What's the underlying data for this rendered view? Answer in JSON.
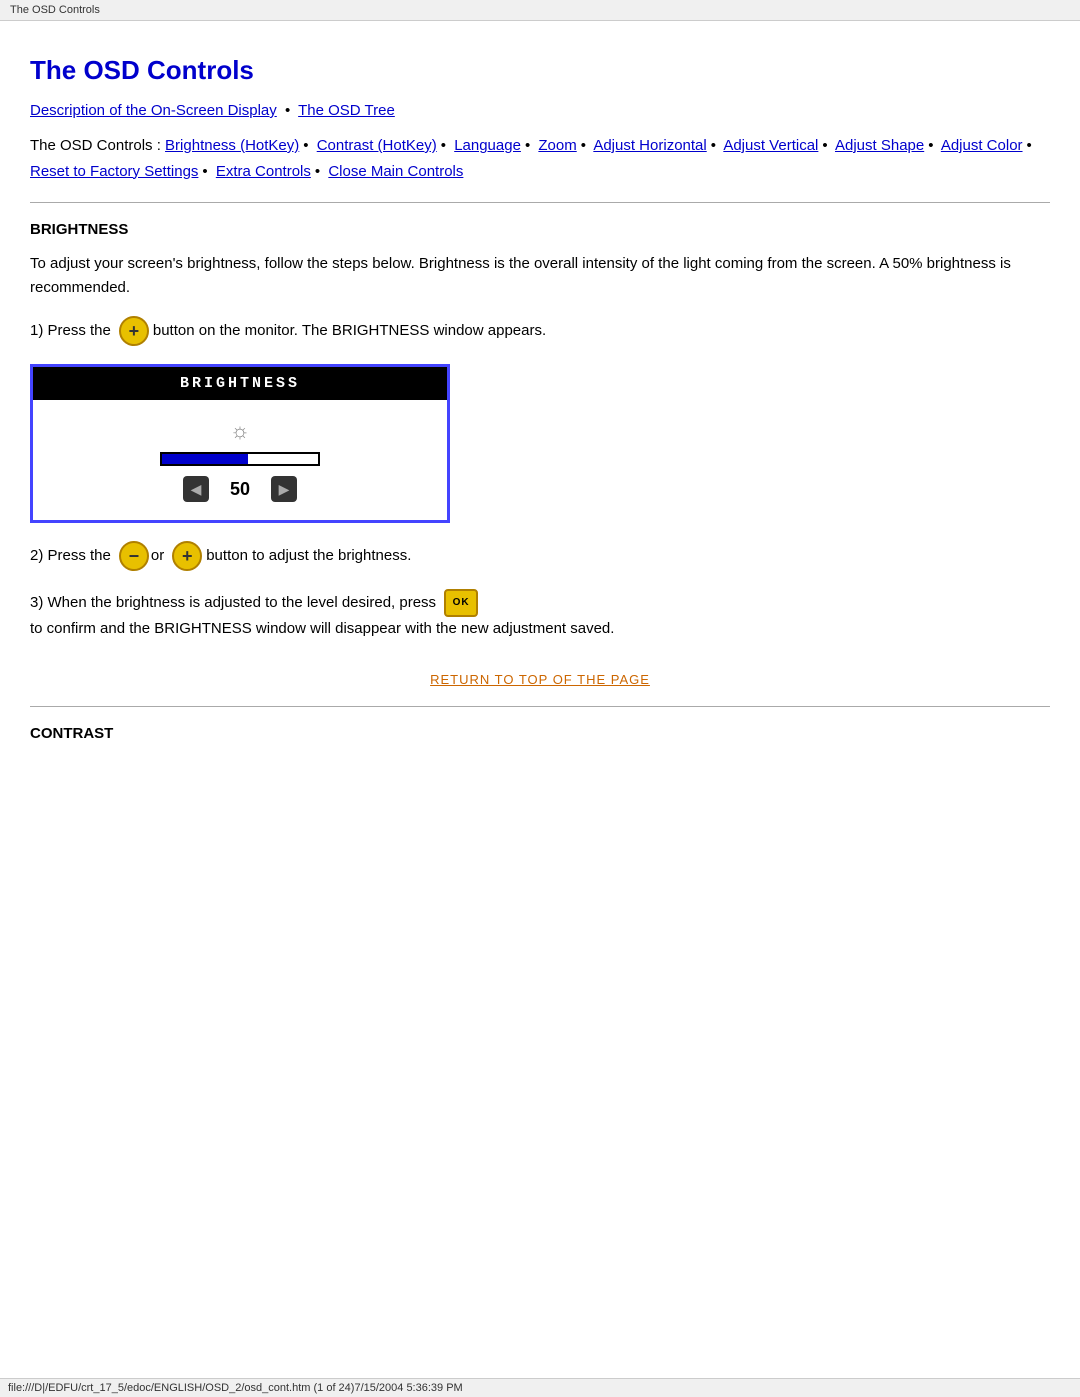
{
  "browserTitle": "The OSD Controls",
  "pageTitle": "The OSD Controls",
  "navLinks": [
    {
      "label": "Description of the On-Screen Display",
      "id": "nav-description"
    },
    {
      "label": "The OSD Tree",
      "id": "nav-tree"
    }
  ],
  "osdControlsIntro": "The OSD Controls : ",
  "osdControlsLinks": [
    {
      "label": "Brightness (HotKey)"
    },
    {
      "label": "Contrast (HotKey)"
    },
    {
      "label": "Language"
    },
    {
      "label": "Zoom"
    },
    {
      "label": "Adjust Horizontal"
    },
    {
      "label": "Adjust Vertical"
    },
    {
      "label": "Adjust Shape"
    },
    {
      "label": "Adjust Color"
    },
    {
      "label": "Reset to Factory Settings"
    },
    {
      "label": "Extra Controls"
    },
    {
      "label": "Close Main Controls"
    }
  ],
  "sections": [
    {
      "id": "brightness",
      "heading": "BRIGHTNESS",
      "description": "To adjust your screen's brightness, follow the steps below. Brightness is the overall intensity of the light coming from the screen. A 50% brightness is recommended.",
      "steps": [
        {
          "number": "1)",
          "beforeIcon": "Press the",
          "icon": "plus",
          "afterIcon": "button on the monitor. The BRIGHTNESS window appears."
        },
        {
          "number": "2)",
          "beforeIcon": "Press the",
          "icon": "minus-plus",
          "afterIcon": "button to adjust the brightness."
        },
        {
          "number": "3)",
          "beforeIcon": "When the brightness is adjusted to the level desired, press",
          "icon": "ok",
          "afterIcon": "to confirm and the BRIGHTNESS window will disappear with the new adjustment saved."
        }
      ],
      "osd": {
        "title": "BRIGHTNESS",
        "value": "50",
        "sunSymbol": "☼"
      }
    }
  ],
  "returnToTopLabel": "RETURN TO TOP OF THE PAGE",
  "contrast": {
    "heading": "CONTRAST"
  },
  "statusBar": "file:///D|/EDFU/crt_17_5/edoc/ENGLISH/OSD_2/osd_cont.htm (1 of 24)7/15/2004 5:36:39 PM"
}
